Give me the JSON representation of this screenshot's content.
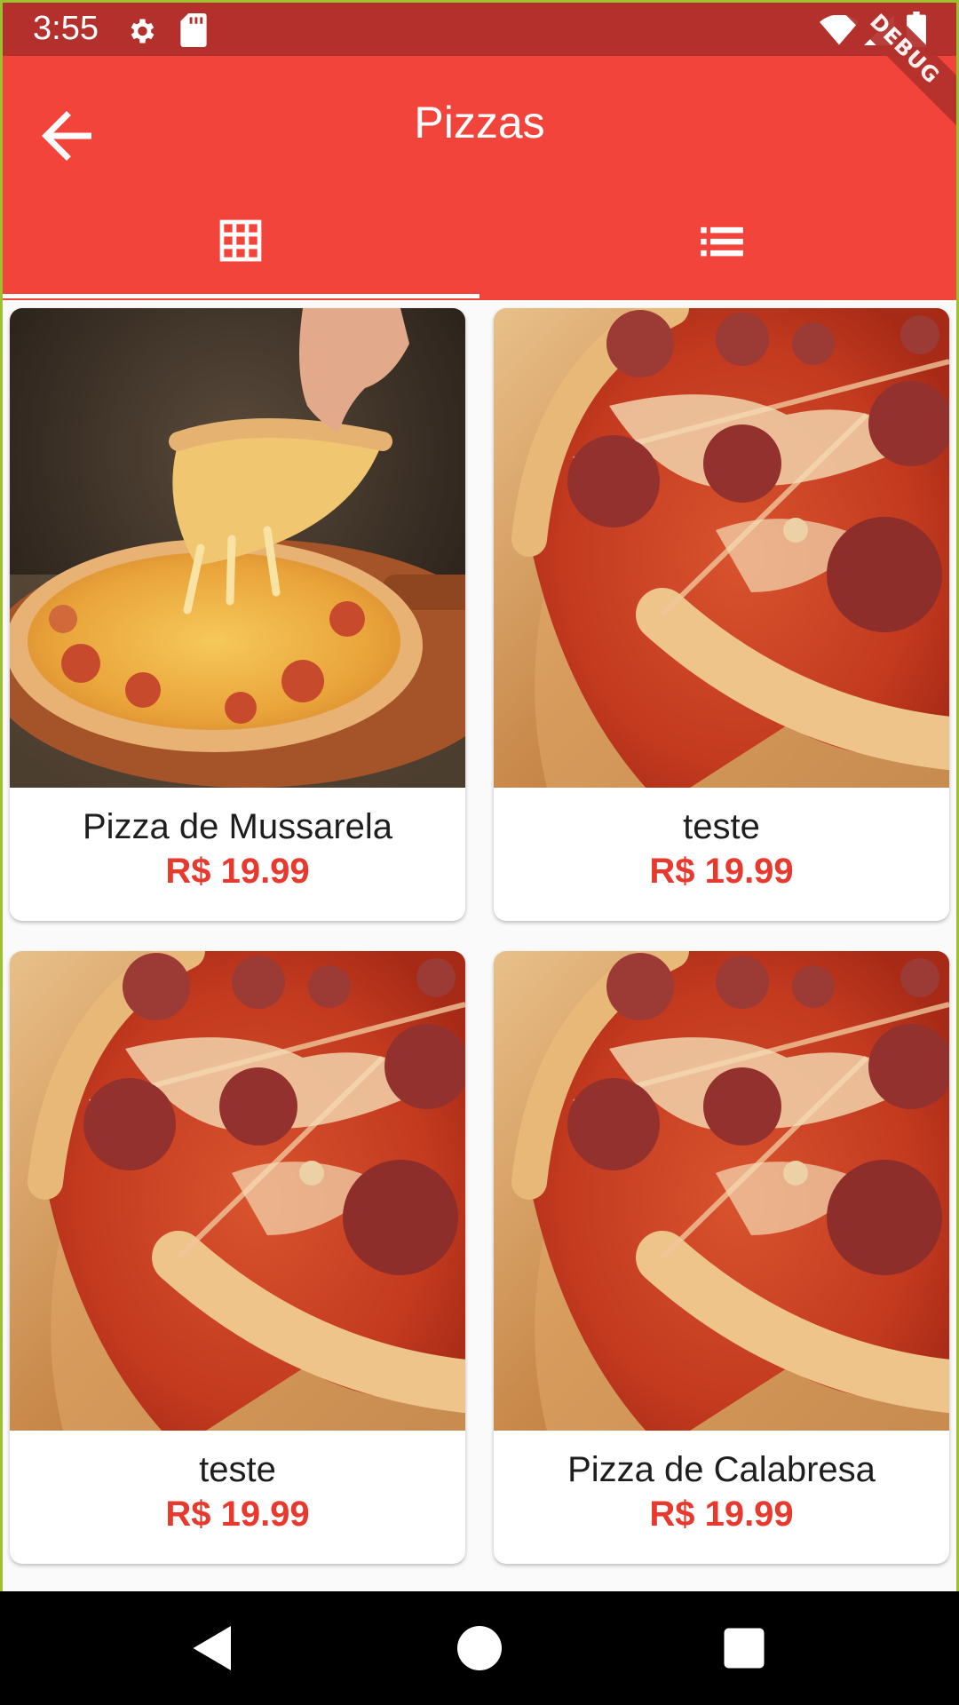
{
  "status_bar": {
    "time": "3:55",
    "icons": [
      "gear-icon",
      "sd-card-icon",
      "wifi-icon",
      "signal-icon",
      "battery-icon"
    ]
  },
  "debug_banner": "DEBUG",
  "app_bar": {
    "title": "Pizzas",
    "back_icon": "arrow-back-icon",
    "tabs": [
      {
        "icon": "grid-icon",
        "selected": true
      },
      {
        "icon": "list-icon",
        "selected": false
      }
    ]
  },
  "products": [
    {
      "name": "Pizza de Mussarela",
      "price": "R$ 19.99",
      "image": "cheese-pizza-photo"
    },
    {
      "name": "teste",
      "price": "R$ 19.99",
      "image": "pepperoni-pizza-photo"
    },
    {
      "name": "teste",
      "price": "R$ 19.99",
      "image": "pepperoni-pizza-photo"
    },
    {
      "name": "Pizza de Calabresa",
      "price": "R$ 19.99",
      "image": "pepperoni-pizza-photo"
    }
  ],
  "nav_bar": {
    "icons": [
      "back-triangle-icon",
      "home-circle-icon",
      "recents-square-icon"
    ]
  },
  "colors": {
    "primary": "#f2443a",
    "status_bar": "#b3302c",
    "price": "#e8392f"
  }
}
